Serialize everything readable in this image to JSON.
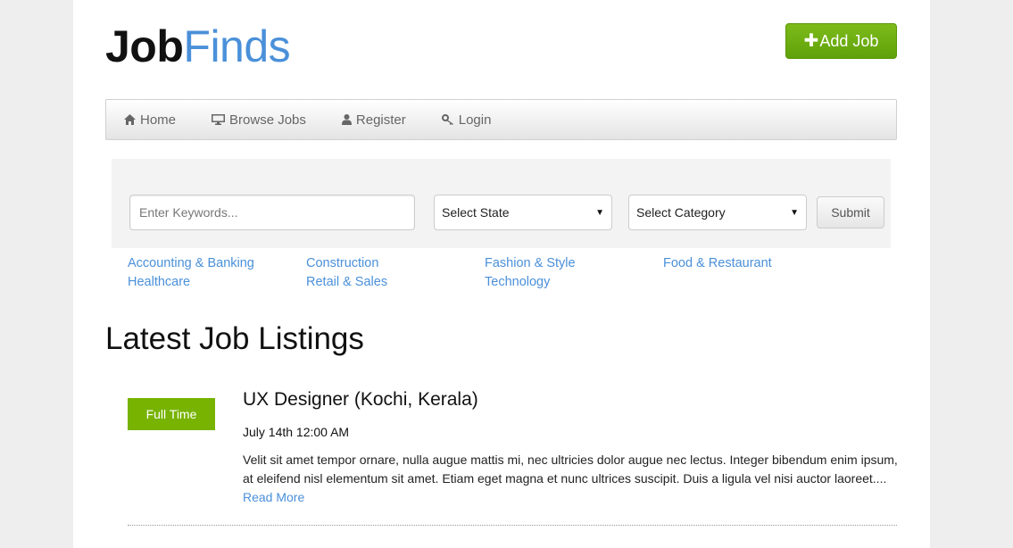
{
  "brand": {
    "part1": "Job",
    "part2": "Finds",
    "part1_color": "#111111",
    "part2_color": "#4a90d9"
  },
  "header": {
    "add_job_label": "Add Job",
    "add_job_icon": "plus-icon",
    "accent": "#6aab10"
  },
  "nav": {
    "items": [
      {
        "label": "Home",
        "icon": "home-icon"
      },
      {
        "label": "Browse Jobs",
        "icon": "monitor-icon"
      },
      {
        "label": "Register",
        "icon": "user-icon"
      },
      {
        "label": "Login",
        "icon": "key-icon"
      }
    ]
  },
  "search": {
    "keywords_placeholder": "Enter Keywords...",
    "keywords_value": "",
    "state_selected": "Select State",
    "category_selected": "Select Category",
    "submit_label": "Submit"
  },
  "categories": [
    "Accounting & Banking",
    "Construction",
    "Fashion & Style",
    "Food & Restaurant",
    "Healthcare",
    "Retail & Sales",
    "Technology"
  ],
  "listings": {
    "title": "Latest Job Listings",
    "items": [
      {
        "type": "Full Time",
        "type_color": "#77b300",
        "title": "UX Designer (Kochi, Kerala)",
        "date": "July 14th 12:00 AM",
        "description": "Velit sit amet tempor ornare, nulla augue mattis mi, nec ultricies dolor augue nec lectus. Integer bibendum enim ipsum, at eleifend nisl elementum sit amet. Etiam eget magna et nunc ultrices suscipit. Duis a ligula vel nisi auctor laoreet....",
        "read_more": "Read More"
      }
    ]
  }
}
